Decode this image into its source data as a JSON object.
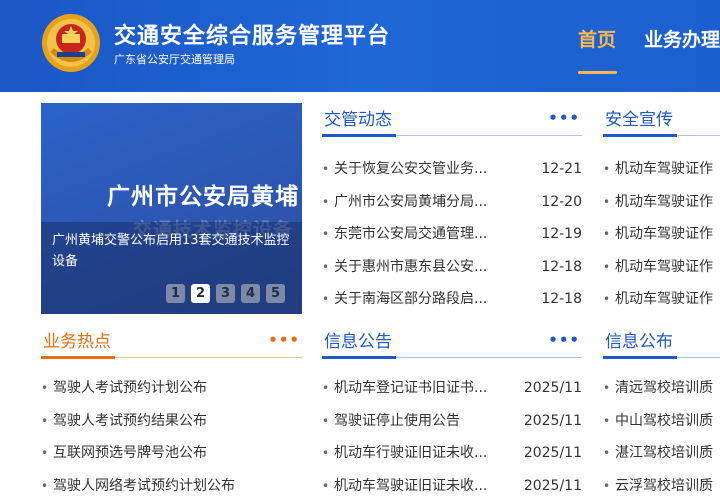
{
  "header": {
    "title": "交通安全综合服务管理平台",
    "subtitle": "广东省公安厅交通管理局",
    "nav": [
      {
        "label": "首页"
      },
      {
        "label": "业务办理"
      }
    ],
    "accent_color": "#ffb84d",
    "bg_color": "#1f66d6"
  },
  "slider": {
    "headline": "广州市公安局黄埔",
    "ghost_text": "交通技术监控设备",
    "caption": "广州黄埔交警公布启用13套交通技术监控设备",
    "pages": [
      "1",
      "2",
      "3",
      "4",
      "5"
    ],
    "active_page": "2"
  },
  "panels": {
    "traffic_news": {
      "title": "交管动态",
      "more": "•••",
      "items": [
        {
          "text": "关于恢复公安交管业务...",
          "date": "12-21"
        },
        {
          "text": "广州市公安局黄埔分局...",
          "date": "12-20"
        },
        {
          "text": "东莞市公安局交通管理...",
          "date": "12-19"
        },
        {
          "text": "关于惠州市惠东县公安...",
          "date": "12-18"
        },
        {
          "text": "关于南海区部分路段启...",
          "date": "12-18"
        }
      ]
    },
    "safety": {
      "title": "安全宣传",
      "items": [
        {
          "text": "机动车驾驶证作"
        },
        {
          "text": "机动车驾驶证作"
        },
        {
          "text": "机动车驾驶证作"
        },
        {
          "text": "机动车驾驶证作"
        },
        {
          "text": "机动车驾驶证作"
        }
      ]
    },
    "hot_business": {
      "title": "业务热点",
      "more": "•••",
      "items": [
        {
          "text": "驾驶人考试预约计划公布"
        },
        {
          "text": "驾驶人考试预约结果公布"
        },
        {
          "text": "互联网预选号牌号池公布"
        },
        {
          "text": "驾驶人网络考试预约计划公布"
        }
      ]
    },
    "notices": {
      "title": "信息公告",
      "more": "•••",
      "items": [
        {
          "text": "机动车登记证书旧证书...",
          "date": "2025/11"
        },
        {
          "text": "驾驶证停止使用公告",
          "date": "2025/11"
        },
        {
          "text": "机动车行驶证旧证未收...",
          "date": "2025/11"
        },
        {
          "text": "机动车驾驶证旧证未收...",
          "date": "2025/11"
        }
      ]
    },
    "info_publish": {
      "title": "信息公布",
      "items": [
        {
          "text": "清远驾校培训质"
        },
        {
          "text": "中山驾校培训质"
        },
        {
          "text": "湛江驾校培训质"
        },
        {
          "text": "云浮驾校培训质"
        }
      ]
    }
  }
}
